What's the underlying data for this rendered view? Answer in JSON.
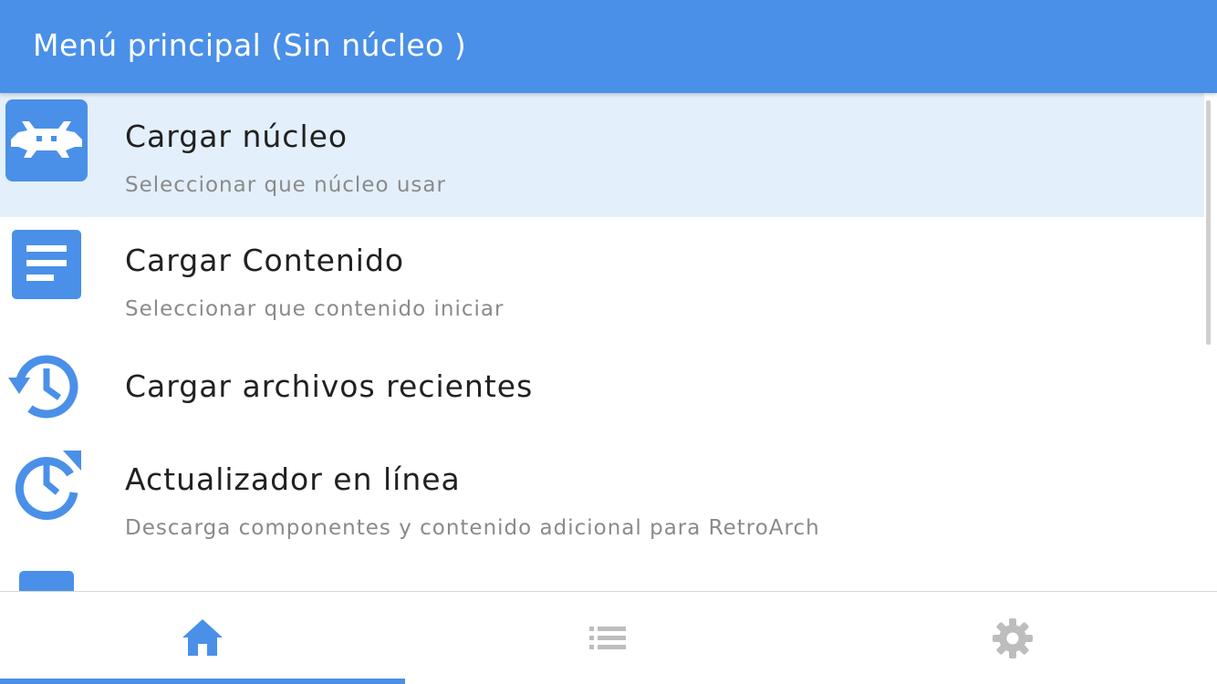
{
  "header": {
    "title": "Menú principal (Sin núcleo )"
  },
  "menu": {
    "items": [
      {
        "title": "Cargar núcleo",
        "subtitle": "Seleccionar que núcleo usar",
        "icon": "retroarch-invader-icon",
        "selected": true
      },
      {
        "title": "Cargar Contenido",
        "subtitle": "Seleccionar que contenido iniciar",
        "icon": "file-icon",
        "selected": false
      },
      {
        "title": "Cargar archivos recientes",
        "subtitle": "",
        "icon": "history-icon",
        "selected": false
      },
      {
        "title": "Actualizador en línea",
        "subtitle": "Descarga componentes y contenido adicional para RetroArch",
        "icon": "update-icon",
        "selected": false
      }
    ]
  },
  "bottom_nav": {
    "tabs": [
      {
        "name": "main-menu",
        "icon": "home-icon",
        "active": true
      },
      {
        "name": "playlists",
        "icon": "list-icon",
        "active": false
      },
      {
        "name": "settings",
        "icon": "gear-icon",
        "active": false
      }
    ]
  },
  "colors": {
    "accent": "#4a90e8",
    "selected_row": "#e3f0fb",
    "inactive_icon": "#bdbdbd",
    "title_text": "#212121",
    "subtitle_text": "#8a8a8a"
  }
}
